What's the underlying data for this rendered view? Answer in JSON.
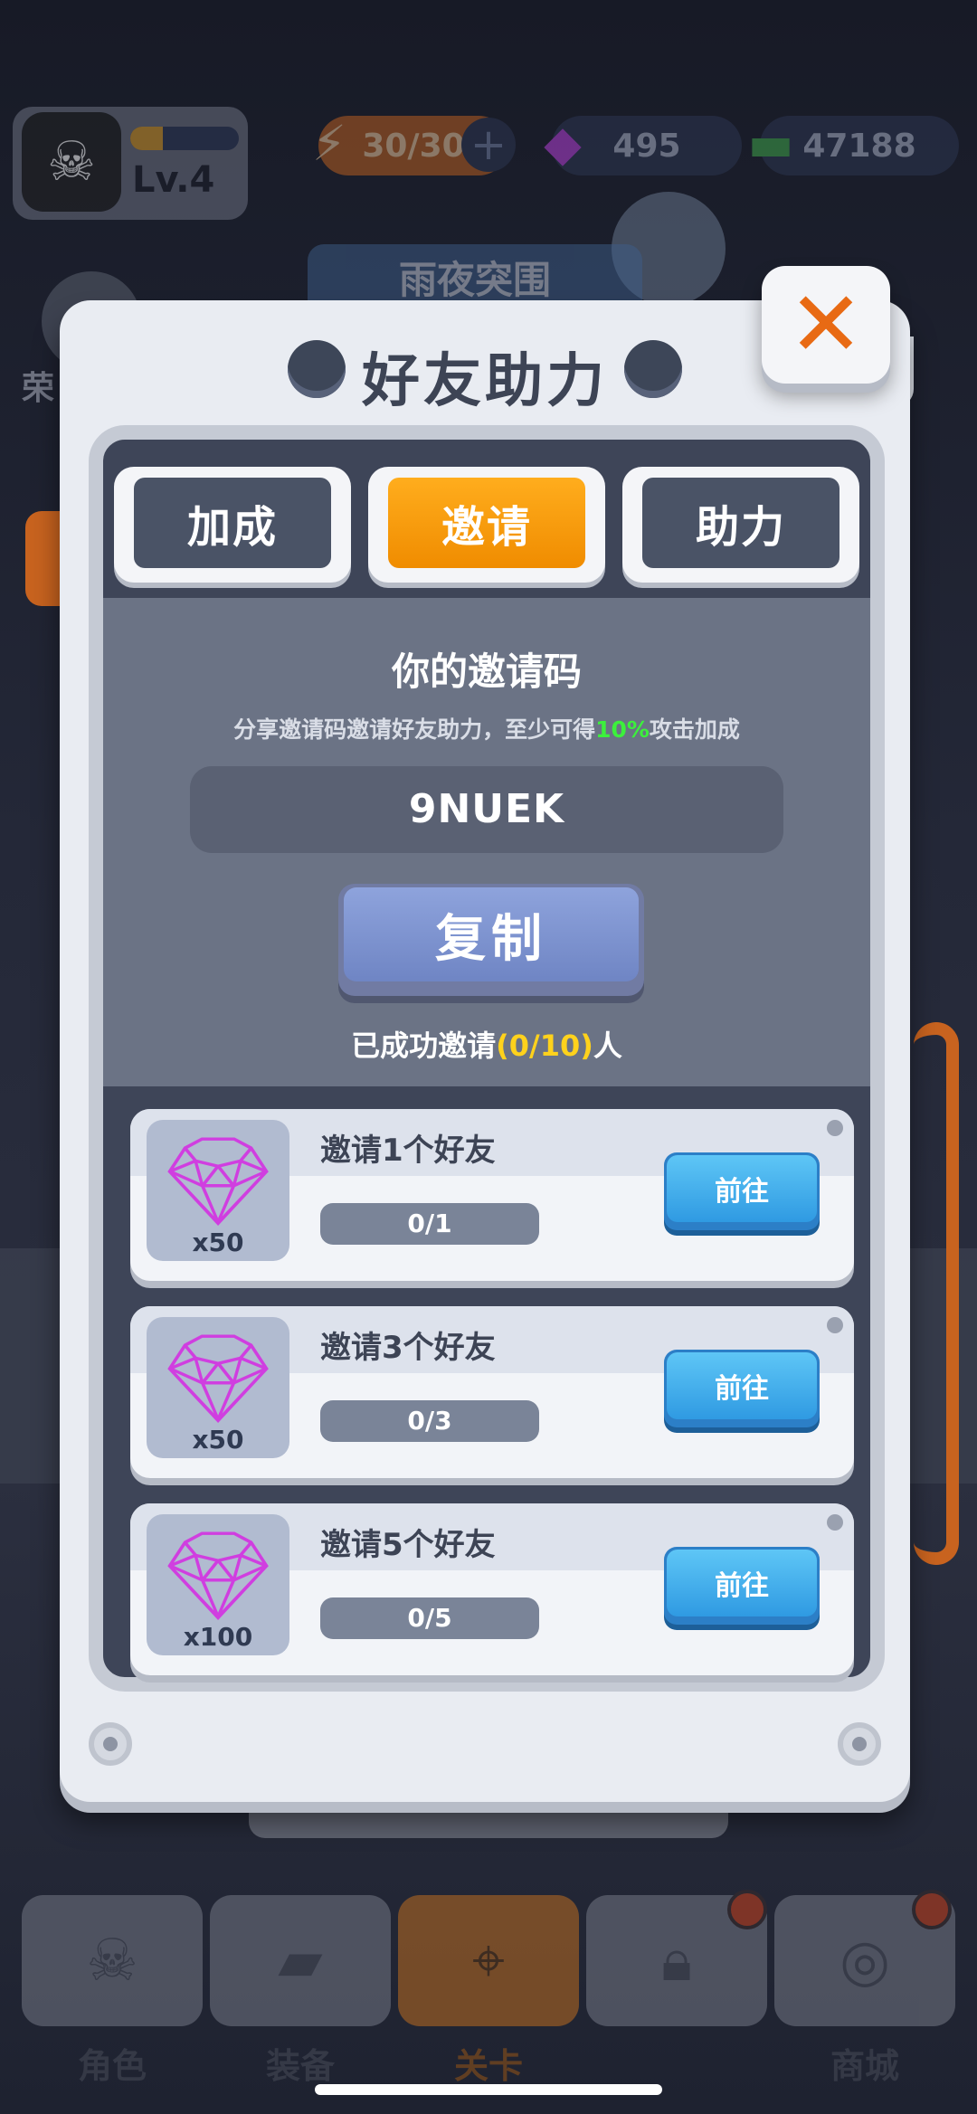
{
  "hud": {
    "level": "Lv.4",
    "level_progress": 0.3,
    "energy": "30/30",
    "gems": "495",
    "cash": "47188"
  },
  "background": {
    "banner": "雨夜突围",
    "left_label": "荣"
  },
  "dialog": {
    "title": "好友助力",
    "close_icon": "close-x-icon",
    "tabs": [
      {
        "label": "加成",
        "active": false
      },
      {
        "label": "邀请",
        "active": true
      },
      {
        "label": "助力",
        "active": false
      }
    ],
    "invite": {
      "title": "你的邀请码",
      "desc_prefix": "分享邀请码邀请好友助力，至少可得",
      "desc_highlight": "10%",
      "desc_suffix": "攻击加成",
      "code": "9NUEK",
      "copy_label": "复制",
      "success_prefix": "已成功邀请",
      "success_count": "(0/10)",
      "success_suffix": "人"
    },
    "tasks": [
      {
        "name": "邀请1个好友",
        "reward_icon": "gem-icon",
        "reward_qty": "x50",
        "progress": "0/1",
        "go_label": "前往"
      },
      {
        "name": "邀请3个好友",
        "reward_icon": "gem-icon",
        "reward_qty": "x50",
        "progress": "0/3",
        "go_label": "前往"
      },
      {
        "name": "邀请5个好友",
        "reward_icon": "gem-icon",
        "reward_qty": "x100",
        "progress": "0/5",
        "go_label": "前往"
      }
    ]
  },
  "bottom_nav": [
    {
      "label": "角色",
      "icon": "skull-icon",
      "badge": false
    },
    {
      "label": "装备",
      "icon": "gun-icon",
      "badge": false
    },
    {
      "label": "关卡",
      "icon": "map-pin-icon",
      "badge": false,
      "active": true
    },
    {
      "label": "",
      "icon": "lock-icon",
      "badge": true
    },
    {
      "label": "商城",
      "icon": "shop-icon",
      "badge": true
    }
  ],
  "colors": {
    "accent_orange": "#f08c00",
    "highlight_green": "#3cf03c",
    "highlight_yellow": "#ffd21c",
    "go_blue": "#2f9ae2",
    "copy_blue": "#6f85c4"
  }
}
